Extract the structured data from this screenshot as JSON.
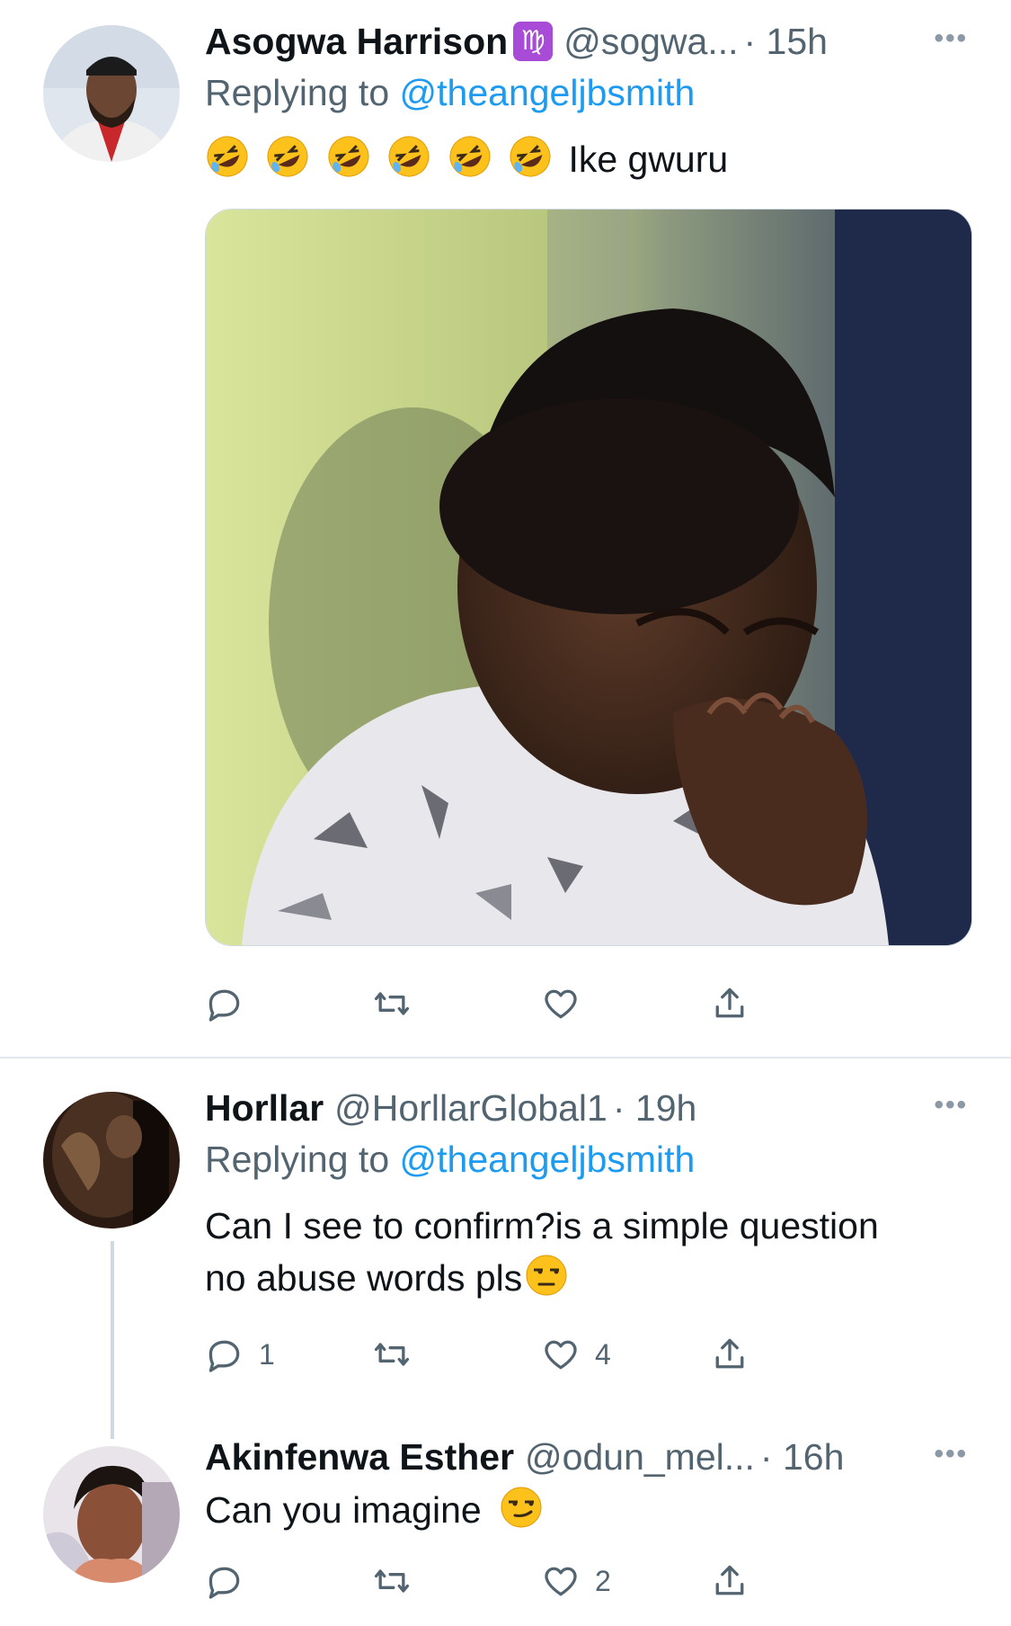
{
  "tweets": [
    {
      "name": "Asogwa Harrison",
      "zodiac": "♍",
      "handle": "@sogwa...",
      "time": "· 15h",
      "replying_prefix": "Replying to",
      "replying_to": "@theangeljbsmith",
      "emoji_count": 6,
      "text_after_emoji": "Ike gwuru",
      "has_media": true,
      "counts": {
        "reply": "",
        "retweet": "",
        "like": ""
      }
    },
    {
      "name": "Horllar",
      "handle": "@HorllarGlobal1",
      "time": "· 19h",
      "replying_prefix": "Replying to",
      "replying_to": "@theangeljbsmith",
      "text_line1": "Can I see to confirm?is a simple question",
      "text_line2": "no abuse words pls",
      "counts": {
        "reply": "1",
        "retweet": "",
        "like": "4"
      }
    },
    {
      "name": "Akinfenwa Esther",
      "handle": "@odun_mel...",
      "time": "· 16h",
      "text": "Can you imagine",
      "counts": {
        "reply": "",
        "retweet": "",
        "like": "2"
      }
    }
  ],
  "colors": {
    "accent": "#1d9bf0",
    "secondary_text": "#536471",
    "divider": "#e1e8ed"
  },
  "icons": [
    "reply-icon",
    "retweet-icon",
    "like-icon",
    "share-icon",
    "more-icon"
  ]
}
